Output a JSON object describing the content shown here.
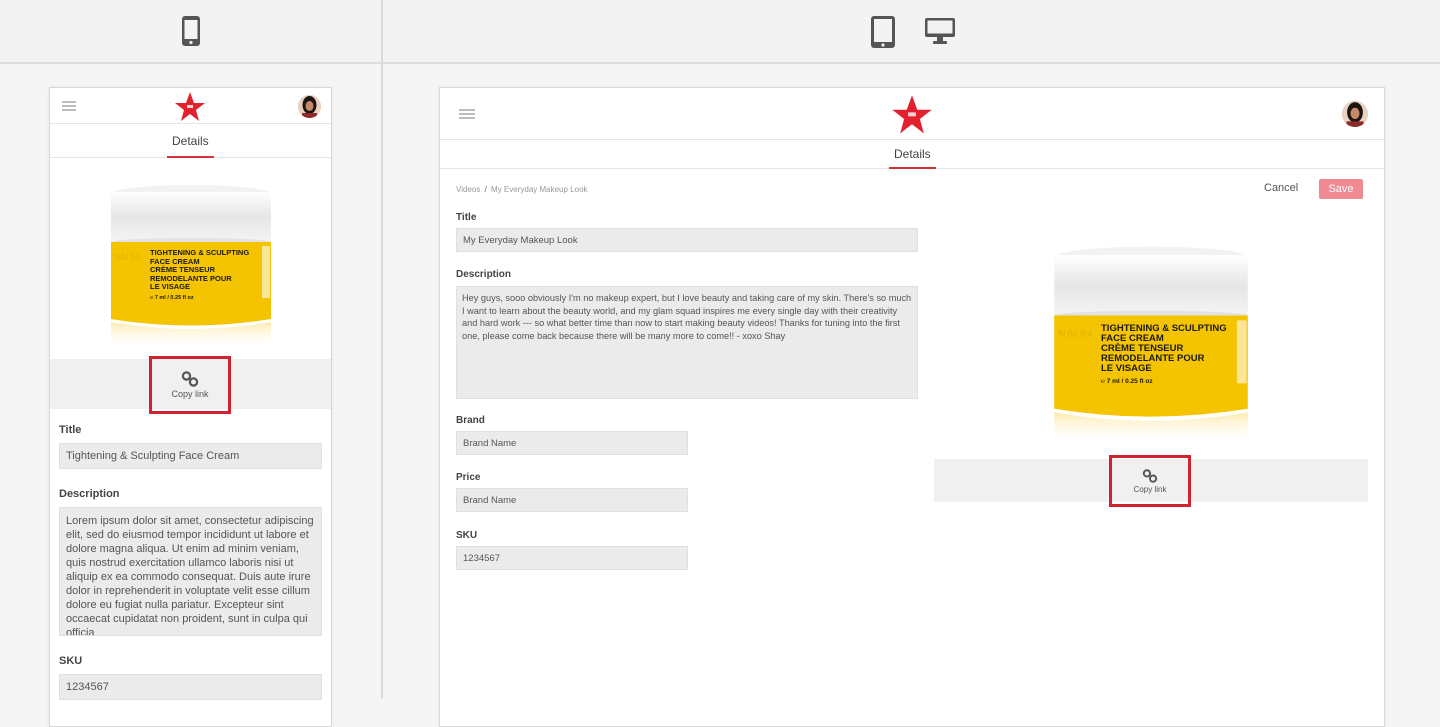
{
  "devices": {
    "mobile_icon": "mobile-phone-icon",
    "tablet_icon": "tablet-icon",
    "desktop_icon": "desktop-monitor-icon"
  },
  "colors": {
    "accent": "#d6303c",
    "highlight_border": "#d0232f",
    "save_button": "#f08a92",
    "jar_yellow": "#f5c400"
  },
  "product": {
    "jar_brand": "NAI 84",
    "jar_line1": "TIGHTENING & SCULPTING",
    "jar_line2": "FACE CREAM",
    "jar_line3": "CRÈME TENSEUR",
    "jar_line4": "REMODELANTE POUR",
    "jar_line5": "LE VISAGE",
    "jar_size": "℮ 7 ml / 0.25 fl oz"
  },
  "mobile": {
    "tab": "Details",
    "copy_link": "Copy link",
    "title_label": "Title",
    "title_value": "Tightening & Sculpting Face Cream",
    "description_label": "Description",
    "description_value": "Lorem ipsum dolor sit amet, consectetur adipiscing elit, sed do eiusmod tempor incididunt ut labore et dolore magna aliqua. Ut enim ad minim veniam, quis nostrud exercitation ullamco laboris nisi ut aliquip ex ea commodo consequat. Duis aute irure dolor in reprehenderit in voluptate velit esse cillum dolore eu fugiat nulla pariatur. Excepteur sint occaecat cupidatat non proident, sunt in culpa qui officia",
    "sku_label": "SKU",
    "sku_value": "1234567"
  },
  "desktop": {
    "tab": "Details",
    "breadcrumb_root": "Videos",
    "breadcrumb_sep": "/",
    "breadcrumb_current": "My Everyday Makeup Look",
    "cancel": "Cancel",
    "save": "Save",
    "title_label": "Title",
    "title_value": "My Everyday Makeup Look",
    "description_label": "Description",
    "description_value": "Hey guys, sooo obviously I'm no makeup expert, but I love beauty and taking care of my skin. There's so much I want to learn about the beauty world, and my glam squad inspires me every single day with their creativity and hard work --- so what better time than now to start making beauty videos! Thanks for tuning into the first one, please come back because there will be many more to come!! - xoxo Shay",
    "brand_label": "Brand",
    "brand_value": "Brand Name",
    "price_label": "Price",
    "price_value": "Brand Name",
    "sku_label": "SKU",
    "sku_value": "1234567",
    "copy_link": "Copy link"
  }
}
